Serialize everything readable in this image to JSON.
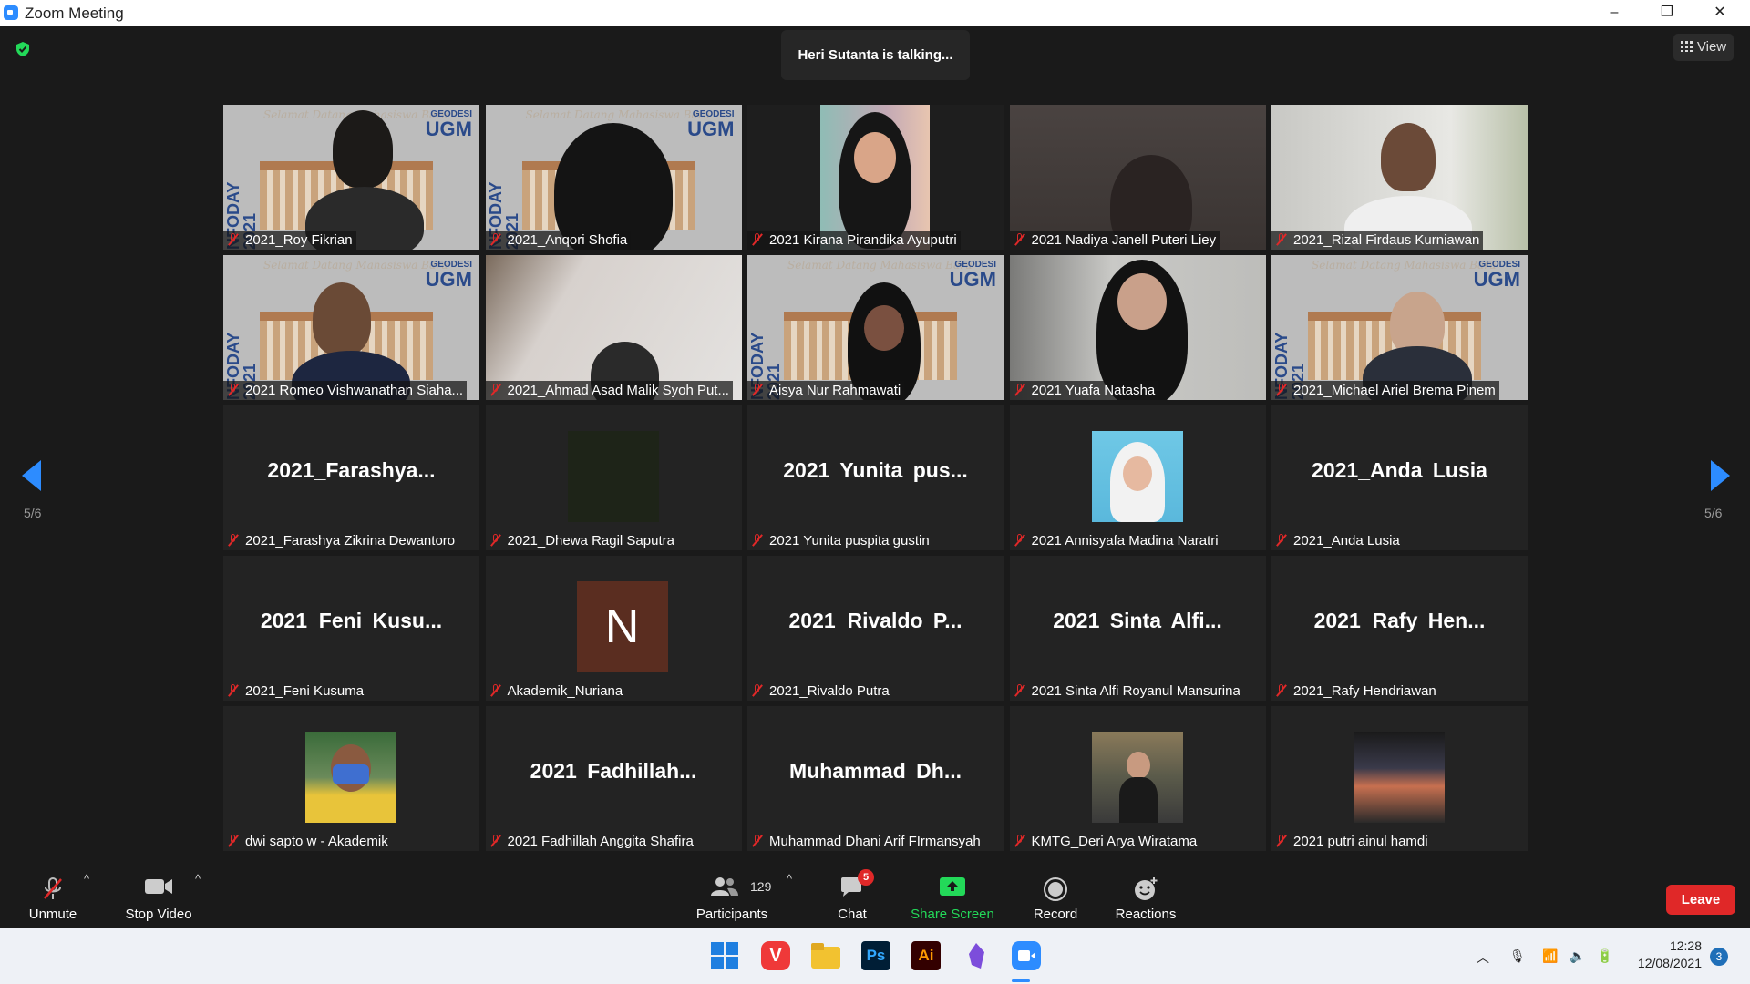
{
  "window": {
    "title": "Zoom Meeting",
    "controls": {
      "minimize": "–",
      "restore": "❐",
      "close": "✕"
    }
  },
  "stage": {
    "talking_indicator": "Heri Sutanta is talking...",
    "view_button": "View",
    "page_left": "5/6",
    "page_right": "5/6"
  },
  "ugm_bg": {
    "brand": "GEODESI",
    "logo": "UGM",
    "side": "NFODAY 2021",
    "script": "Selamat Datang Mahasiswa Baru"
  },
  "tiles": [
    {
      "name": "2021_Roy Fikrian",
      "big": ""
    },
    {
      "name": "2021_Anqori Shofia",
      "big": ""
    },
    {
      "name": "2021 Kirana Pirandika Ayuputri",
      "big": ""
    },
    {
      "name": "2021 Nadiya Janell Puteri Liey",
      "big": ""
    },
    {
      "name": "2021_Rizal Firdaus Kurniawan",
      "big": ""
    },
    {
      "name": "2021 Romeo Vishwanathan Siaha...",
      "big": ""
    },
    {
      "name": "2021_Ahmad Asad Malik Syoh Put...",
      "big": ""
    },
    {
      "name": "Aisya Nur Rahmawati",
      "big": ""
    },
    {
      "name": "2021 Yuafa Natasha",
      "big": ""
    },
    {
      "name": "2021_Michael Ariel Brema Pinem",
      "big": ""
    },
    {
      "name": "2021_Farashya Zikrina Dewantoro",
      "big": "2021_Farashya..."
    },
    {
      "name": "2021_Dhewa Ragil Saputra",
      "big": ""
    },
    {
      "name": "2021 Yunita puspita gustin",
      "big": "2021 Yunita pus..."
    },
    {
      "name": "2021 Annisyafa Madina Naratri",
      "big": ""
    },
    {
      "name": "2021_Anda Lusia",
      "big": "2021_Anda Lusia"
    },
    {
      "name": "2021_Feni Kusuma",
      "big": "2021_Feni Kusu..."
    },
    {
      "name": "Akademik_Nuriana",
      "big": "",
      "avatar_letter": "N"
    },
    {
      "name": "2021_Rivaldo Putra",
      "big": "2021_Rivaldo P..."
    },
    {
      "name": "2021 Sinta Alfi Royanul Mansurina",
      "big": "2021 Sinta Alfi..."
    },
    {
      "name": "2021_Rafy Hendriawan",
      "big": "2021_Rafy Hen..."
    },
    {
      "name": "dwi sapto w - Akademik",
      "big": ""
    },
    {
      "name": "2021 Fadhillah Anggita Shafira",
      "big": "2021 Fadhillah..."
    },
    {
      "name": "Muhammad Dhani Arif FIrmansyah",
      "big": "Muhammad Dh..."
    },
    {
      "name": "KMTG_Deri Arya Wiratama",
      "big": ""
    },
    {
      "name": "2021 putri ainul hamdi",
      "big": ""
    }
  ],
  "toolbar": {
    "unmute": "Unmute",
    "stop_video": "Stop Video",
    "participants": "Participants",
    "participants_count": "129",
    "chat": "Chat",
    "chat_badge": "5",
    "share_screen": "Share Screen",
    "record": "Record",
    "reactions": "Reactions",
    "leave": "Leave",
    "accent_green": "#23d959",
    "leave_color": "#e02828"
  },
  "taskbar": {
    "apps": [
      "windows-start",
      "vivaldi",
      "file-explorer",
      "photoshop",
      "illustrator",
      "obsidian",
      "zoom"
    ],
    "ps_label": "Ps",
    "ai_label": "Ai",
    "time": "12:28",
    "date": "12/08/2021",
    "notification_count": "3"
  }
}
